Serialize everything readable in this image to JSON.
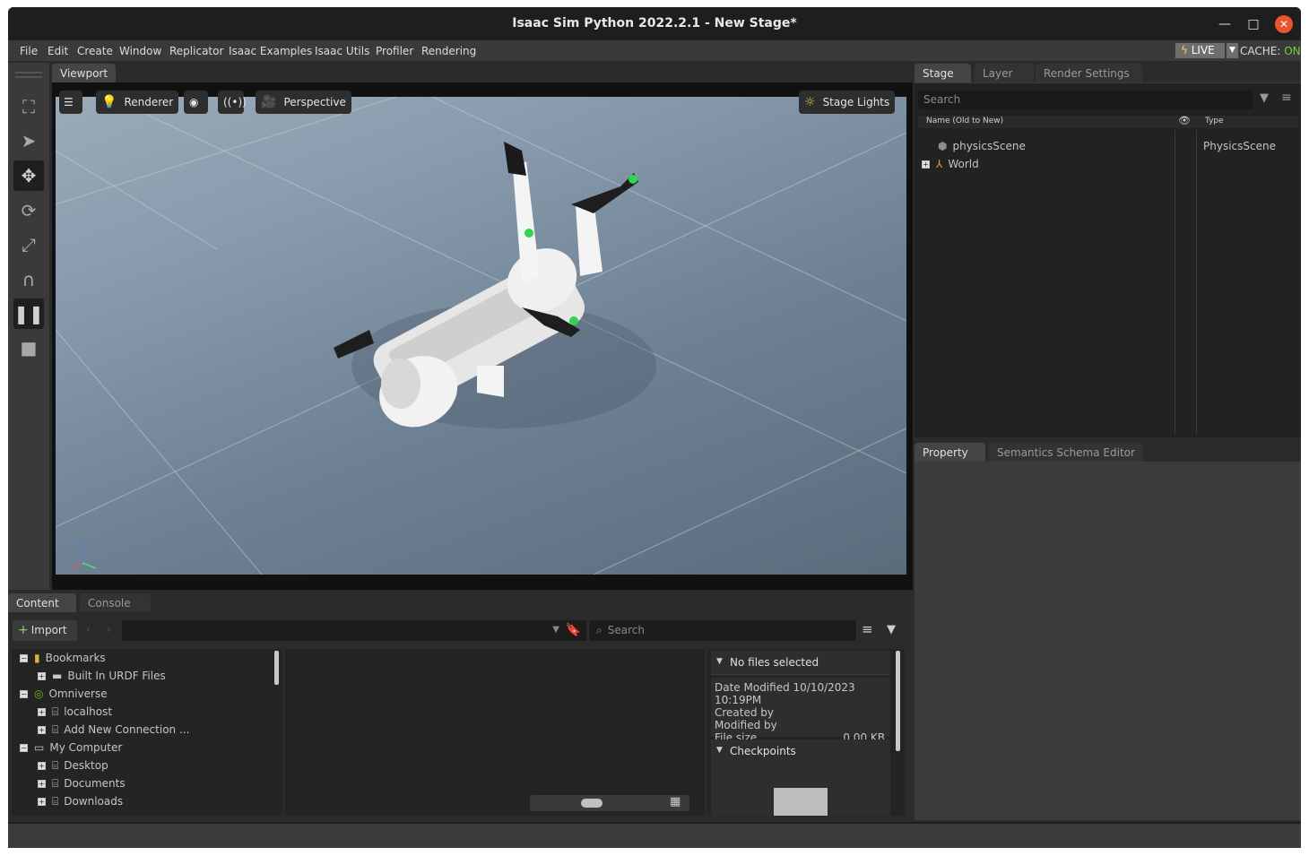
{
  "window": {
    "title": "Isaac Sim Python 2022.2.1 - New Stage*"
  },
  "menu": [
    "File",
    "Edit",
    "Create",
    "Window",
    "Replicator",
    "Isaac Examples",
    "Isaac Utils",
    "Profiler",
    "Rendering"
  ],
  "status": {
    "live_label": "LIVE",
    "cache_label": "CACHE:",
    "cache_value": "ON"
  },
  "viewport": {
    "tab": "Viewport",
    "renderer_label": "Renderer",
    "camera_label": "Perspective",
    "lights_label": "Stage Lights"
  },
  "stage": {
    "tabs": [
      "Stage",
      "Layer",
      "Render Settings"
    ],
    "search_placeholder": "Search",
    "col_name": "Name (Old to New)",
    "col_type": "Type",
    "items": [
      {
        "name": "physicsScene",
        "type": "PhysicsScene"
      },
      {
        "name": "World",
        "type": ""
      }
    ]
  },
  "property": {
    "tabs": [
      "Property",
      "Semantics Schema Editor"
    ]
  },
  "content": {
    "tabs": [
      "Content",
      "Console"
    ],
    "import_label": "Import",
    "search_placeholder": "Search",
    "tree": [
      {
        "label": "Bookmarks",
        "level": 0,
        "icon": "bookmark-icon"
      },
      {
        "label": "Built In URDF Files",
        "level": 1,
        "icon": "folder-icon"
      },
      {
        "label": "Omniverse",
        "level": 0,
        "icon": "omniverse-icon"
      },
      {
        "label": "localhost",
        "level": 1,
        "icon": "drive-icon"
      },
      {
        "label": "Add New Connection ...",
        "level": 1,
        "icon": "add-connection-icon"
      },
      {
        "label": "My Computer",
        "level": 0,
        "icon": "computer-icon"
      },
      {
        "label": "Desktop",
        "level": 1,
        "icon": "drive-icon"
      },
      {
        "label": "Documents",
        "level": 1,
        "icon": "drive-icon"
      },
      {
        "label": "Downloads",
        "level": 1,
        "icon": "drive-icon"
      }
    ],
    "details": {
      "header": "No files selected",
      "date_modified": "Date Modified 10/10/2023 10:19PM",
      "created_by": "Created by",
      "modified_by": "Modified by",
      "file_size_label": "File size",
      "file_size_value": "0.00 KB",
      "checkpoints": "Checkpoints"
    }
  }
}
